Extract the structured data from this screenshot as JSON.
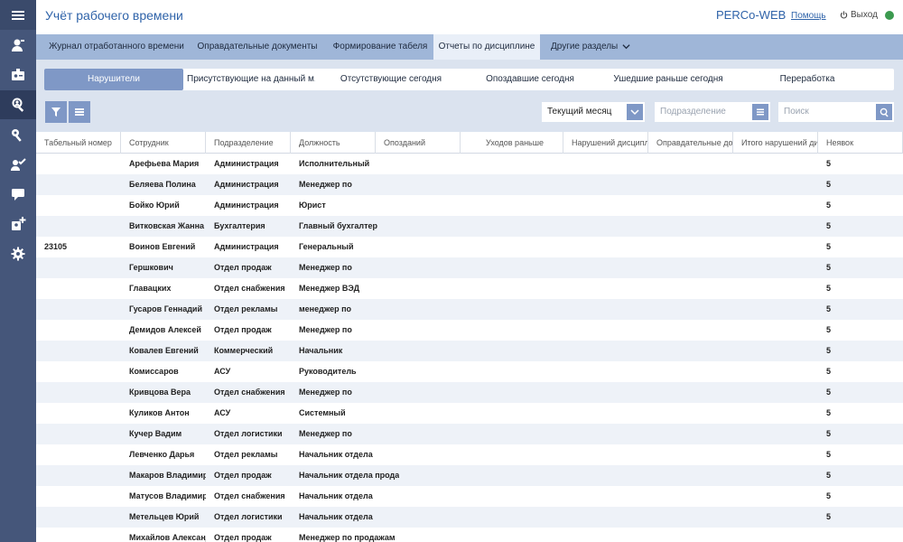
{
  "header": {
    "title": "Учёт рабочего времени",
    "brand": "PERCo-WEB",
    "help": "Помощь",
    "logout": "Выход",
    "status_color": "#3c9a4f"
  },
  "sidebar": {
    "icons": [
      "menu-icon",
      "user-card-icon",
      "badge-icon",
      "user-search-icon",
      "key-icon",
      "user-check-icon",
      "chat-icon",
      "user-add-icon",
      "gear-icon"
    ],
    "active_index": 3
  },
  "tabs": [
    {
      "label": "Журнал отработанного времени"
    },
    {
      "label": "Оправдательные документы"
    },
    {
      "label": "Формирование табеля"
    },
    {
      "label": "Отчеты по дисциплине"
    },
    {
      "label": "Другие разделы"
    }
  ],
  "subtabs": [
    {
      "label": "Нарушители"
    },
    {
      "label": "Присутствующие на данный м..."
    },
    {
      "label": "Отсутствующие сегодня"
    },
    {
      "label": "Опоздавшие сегодня"
    },
    {
      "label": "Ушедшие раньше сегодня"
    },
    {
      "label": "Переработка"
    }
  ],
  "filters": {
    "period": "Текущий месяц",
    "department_placeholder": "Подразделение",
    "search_placeholder": "Поиск"
  },
  "table": {
    "columns": [
      "Табельный номер",
      "Сотрудник",
      "Подразделение",
      "Должность",
      "Опозданий",
      "Уходов раньше",
      "Нарушений дисциплины",
      "Оправдательные документы",
      "Итого нарушений дисциплины",
      "Неявок"
    ],
    "rows": [
      {
        "tab": "",
        "name": "Арефьева Мария",
        "dept": "Администрация",
        "pos": "Исполнительный",
        "abs": "5"
      },
      {
        "tab": "",
        "name": "Беляева Полина",
        "dept": "Администрация",
        "pos": "Менеджер по",
        "abs": "5"
      },
      {
        "tab": "",
        "name": "Бойко Юрий",
        "dept": "Администрация",
        "pos": "Юрист",
        "abs": "5"
      },
      {
        "tab": "",
        "name": "Витковская Жанна",
        "dept": "Бухгалтерия",
        "pos": "Главный бухгалтер",
        "abs": "5"
      },
      {
        "tab": "23105",
        "name": "Воинов Евгений",
        "dept": "Администрация",
        "pos": "Генеральный",
        "abs": "5"
      },
      {
        "tab": "",
        "name": "Гершкович",
        "dept": "Отдел продаж",
        "pos": "Менеджер по",
        "abs": "5"
      },
      {
        "tab": "",
        "name": "Главацких",
        "dept": "Отдел снабжения",
        "pos": "Менеджер ВЭД",
        "abs": "5"
      },
      {
        "tab": "",
        "name": "Гусаров Геннадий",
        "dept": "Отдел рекламы",
        "pos": "менеджер по",
        "abs": "5"
      },
      {
        "tab": "",
        "name": "Демидов Алексей",
        "dept": "Отдел продаж",
        "pos": "Менеджер по",
        "abs": "5"
      },
      {
        "tab": "",
        "name": "Ковалев Евгений",
        "dept": "Коммерческий",
        "pos": "Начальник",
        "abs": "5"
      },
      {
        "tab": "",
        "name": "Комиссаров",
        "dept": "АСУ",
        "pos": "Руководитель",
        "abs": "5"
      },
      {
        "tab": "",
        "name": "Кривцова Вера",
        "dept": "Отдел снабжения",
        "pos": "Менеджер по",
        "abs": "5"
      },
      {
        "tab": "",
        "name": "Куликов Антон",
        "dept": "АСУ",
        "pos": "Системный",
        "abs": "5"
      },
      {
        "tab": "",
        "name": "Кучер Вадим",
        "dept": "Отдел логистики",
        "pos": "Менеджер по",
        "abs": "5"
      },
      {
        "tab": "",
        "name": "Левченко Дарья",
        "dept": "Отдел рекламы",
        "pos": "Начальник отдела",
        "abs": "5"
      },
      {
        "tab": "",
        "name": "Макаров Владимир",
        "dept": "Отдел продаж",
        "pos": "Начальник отдела продаж",
        "abs": "5"
      },
      {
        "tab": "",
        "name": "Матусов Владимир",
        "dept": "Отдел снабжения",
        "pos": "Начальник отдела",
        "abs": "5"
      },
      {
        "tab": "",
        "name": "Метельцев Юрий",
        "dept": "Отдел логистики",
        "pos": "Начальник отдела",
        "abs": "5"
      },
      {
        "tab": "",
        "name": "Михайлов Александр",
        "dept": "Отдел продаж",
        "pos": "Менеджер по продажам",
        "abs": ""
      }
    ]
  }
}
